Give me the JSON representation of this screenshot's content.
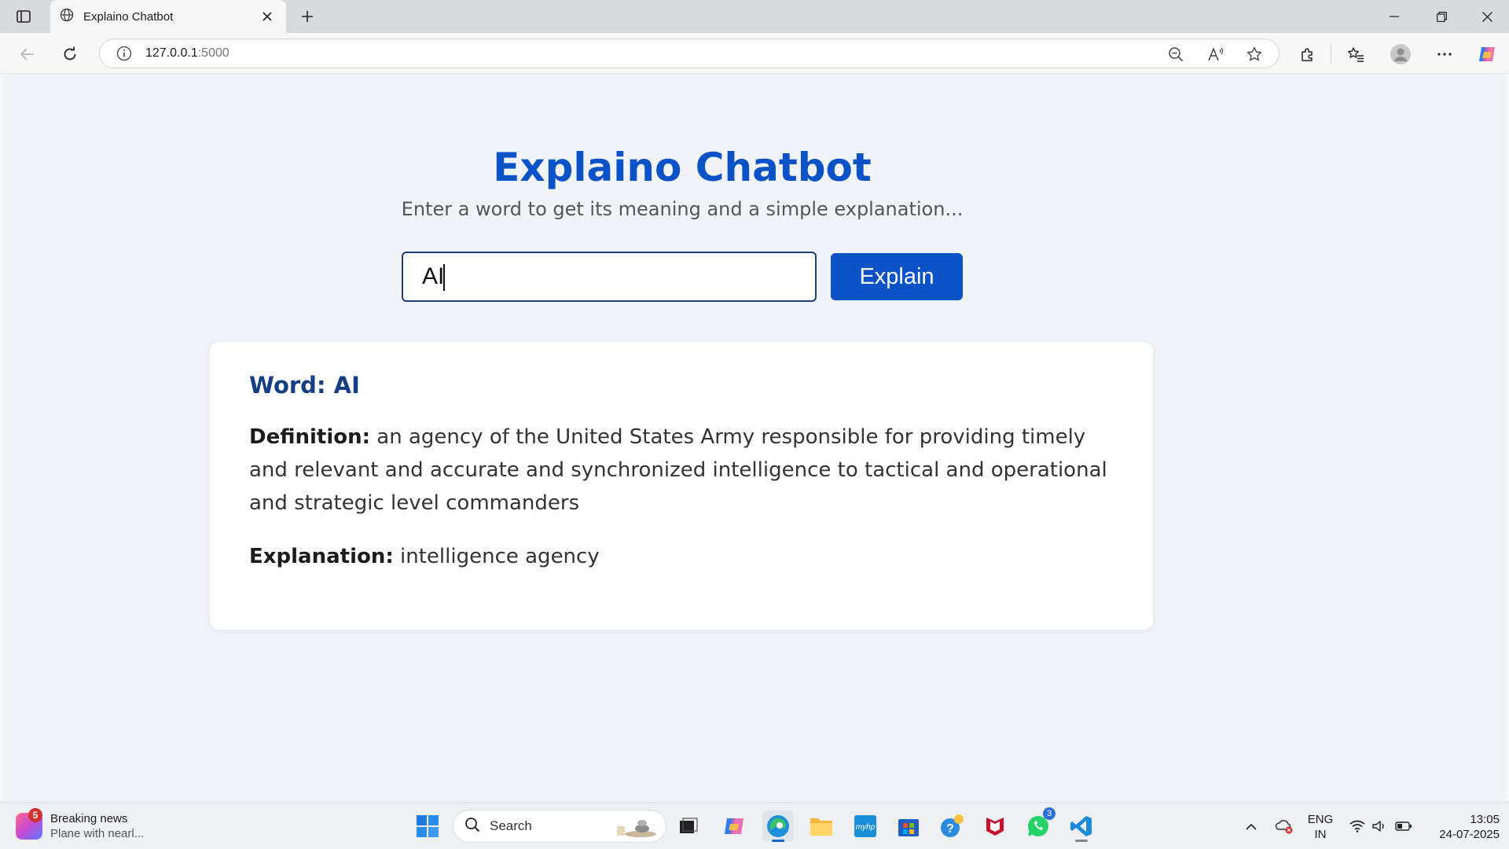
{
  "browser": {
    "tab_title": "Explaino Chatbot",
    "address_host": "127.0.0.1",
    "address_port": ":5000"
  },
  "page": {
    "title": "Explaino Chatbot",
    "subtitle": "Enter a word to get its meaning and a simple explanation...",
    "input_value": "AI",
    "button_label": "Explain",
    "result": {
      "word_label": "Word: AI",
      "definition_label": "Definition:",
      "definition_text": "an agency of the United States Army responsible for providing timely and relevant and accurate and synchronized intelligence to tactical and operational and strategic level commanders",
      "explanation_label": "Explanation:",
      "explanation_text": "intelligence agency"
    }
  },
  "taskbar": {
    "news_title": "Breaking news",
    "news_sub": "Plane with nearl...",
    "news_badge": "5",
    "search_label": "Search",
    "whatsapp_badge": "3",
    "lang_line1": "ENG",
    "lang_line2": "IN",
    "time": "13:05",
    "date": "24-07-2025"
  },
  "colors": {
    "accent": "#0b52c7",
    "word_heading": "#163f83"
  }
}
